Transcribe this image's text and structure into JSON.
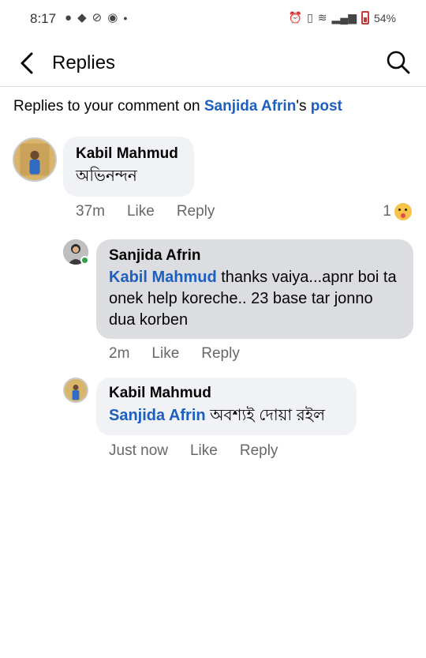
{
  "status_bar": {
    "time": "8:17",
    "left_icons": [
      "messenger-icon",
      "chat-icon",
      "media-icon",
      "app-icon",
      "dot-icon"
    ],
    "right_icons": [
      "alarm-icon",
      "vibrate-icon",
      "wifi-icon",
      "signal-icon",
      "battery-icon"
    ],
    "battery": "54%"
  },
  "header": {
    "title": "Replies"
  },
  "context": {
    "prefix": "Replies to your comment on ",
    "name": "Sanjida Afrin",
    "possessive": "'s ",
    "post": "post"
  },
  "comments": [
    {
      "author": "Kabil Mahmud",
      "mention": "",
      "text": "অভিনন্দন",
      "time": "37m",
      "like": "Like",
      "reply": "Reply",
      "reaction_count": "1",
      "reaction_icon": "care-reaction-icon"
    },
    {
      "author": "Sanjida Afrin",
      "mention": "Kabil Mahmud",
      "text": " thanks vaiya...apnr boi ta onek help koreche.. 23 base tar jonno dua korben",
      "time": "2m",
      "like": "Like",
      "reply": "Reply"
    },
    {
      "author": "Kabil Mahmud",
      "mention": "Sanjida Afrin",
      "text": " অবশ্যই দোয়া রইল",
      "time": "Just now",
      "like": "Like",
      "reply": "Reply"
    }
  ],
  "colors": {
    "link": "#1d5fbf",
    "bubble": "#f0f2f5",
    "bubble_highlight": "#dcdde0",
    "meta": "#65676b",
    "online": "#31a24c"
  }
}
